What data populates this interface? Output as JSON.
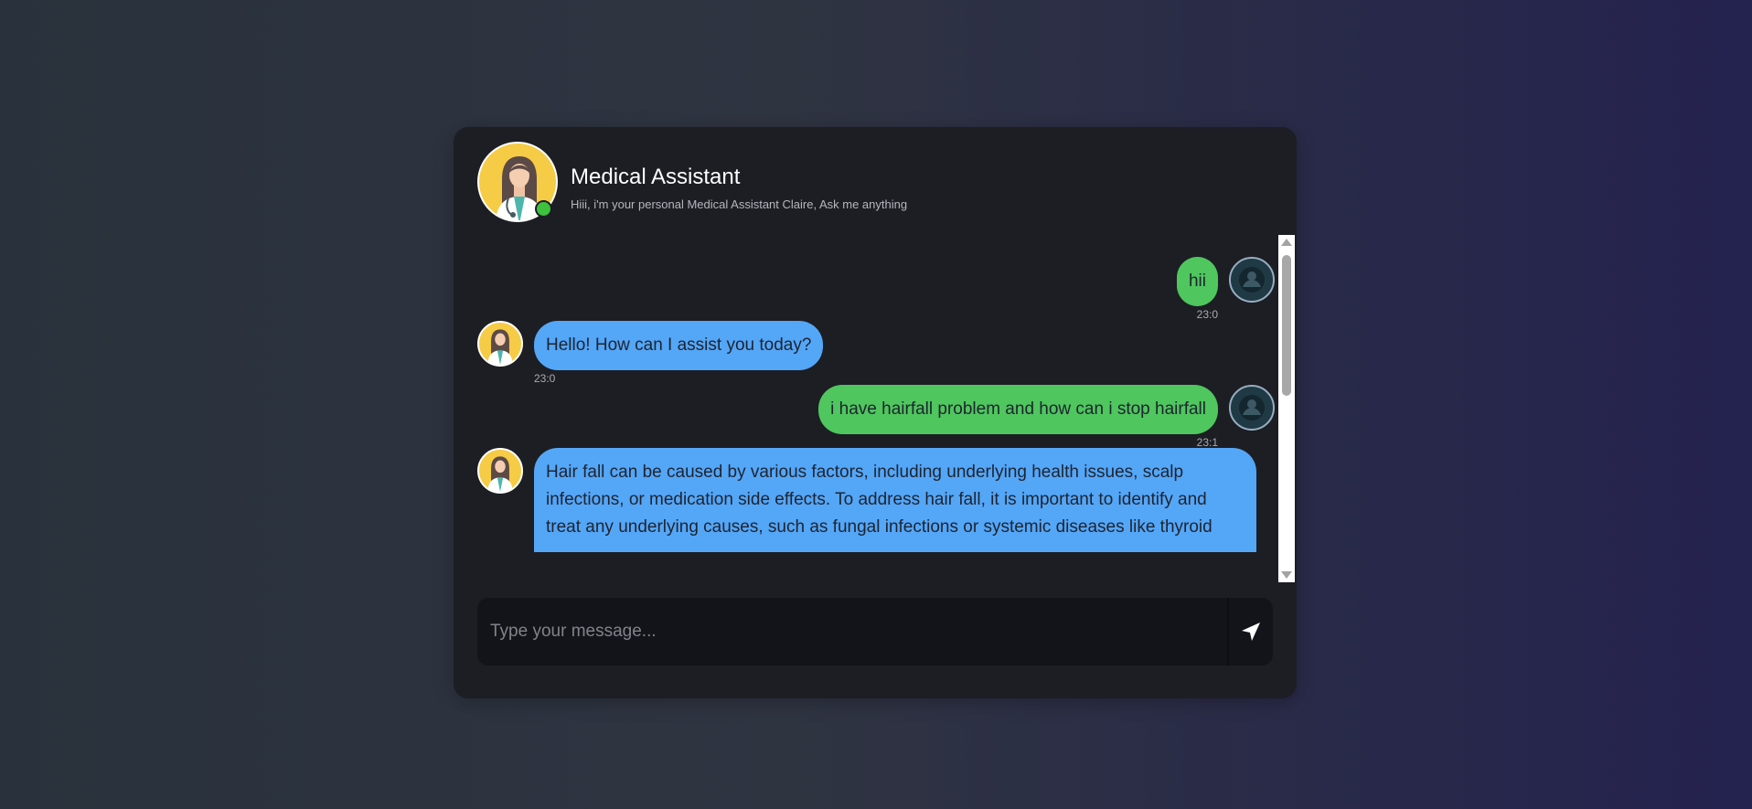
{
  "header": {
    "title": "Medical Assistant",
    "subtitle": "Hiii, i'm your personal Medical Assistant Claire, Ask me anything",
    "status": "online"
  },
  "messages": [
    {
      "sender": "user",
      "text": "hii",
      "time": "23:0"
    },
    {
      "sender": "bot",
      "text": "Hello! How can I assist you today?",
      "time": "23:0"
    },
    {
      "sender": "user",
      "text": "i have hairfall problem and how can i stop hairfall",
      "time": "23:1"
    },
    {
      "sender": "bot",
      "text": "Hair fall can be caused by various factors, including underlying health issues, scalp infections, or medication side effects. To address hair fall, it is important to identify and treat any underlying causes, such as fungal infections or systemic diseases like thyroid"
    }
  ],
  "input": {
    "placeholder": "Type your message..."
  },
  "icons": {
    "bot_avatar": "doctor-avatar-icon",
    "user_avatar": "user-avatar-icon",
    "send": "send-arrow-icon"
  },
  "colors": {
    "user_bubble": "#4fc65e",
    "bot_bubble": "#54a6f7",
    "status_online": "#3ec13d"
  }
}
